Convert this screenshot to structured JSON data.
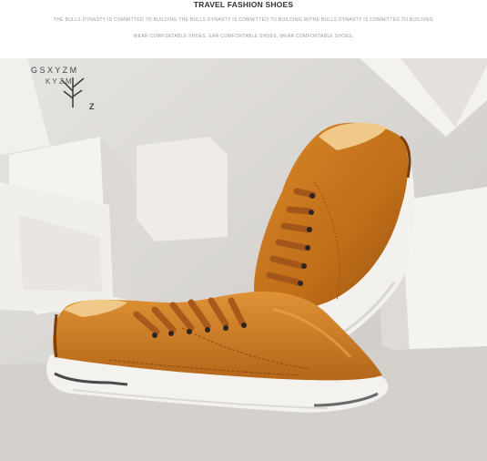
{
  "header": {
    "title": "TRAVEL FASHION SHOES",
    "tagline_line1": "THE BULLS DYNASTY IS COMMITTED TO BUILDING THE BULLS DYNASTY IS COMMITTED TO BUILDING WITHE BULLS DYNASTY IS COMMITTED TO BUILDING",
    "tagline_line2": "WEAR COMFORTABLE SHOES, EAR COMFORTABLE SHOES, WEAR COMFORTABLE SHOES,"
  },
  "photo": {
    "wall_letter": "Z",
    "tree_letters": "G Z S X Y Z M",
    "colors": {
      "leather": "#c8781c",
      "leather_dark": "#8a4a10",
      "sole": "#f4f2ee",
      "background": "#d9d6d2",
      "block": "#f3f1ee"
    }
  }
}
